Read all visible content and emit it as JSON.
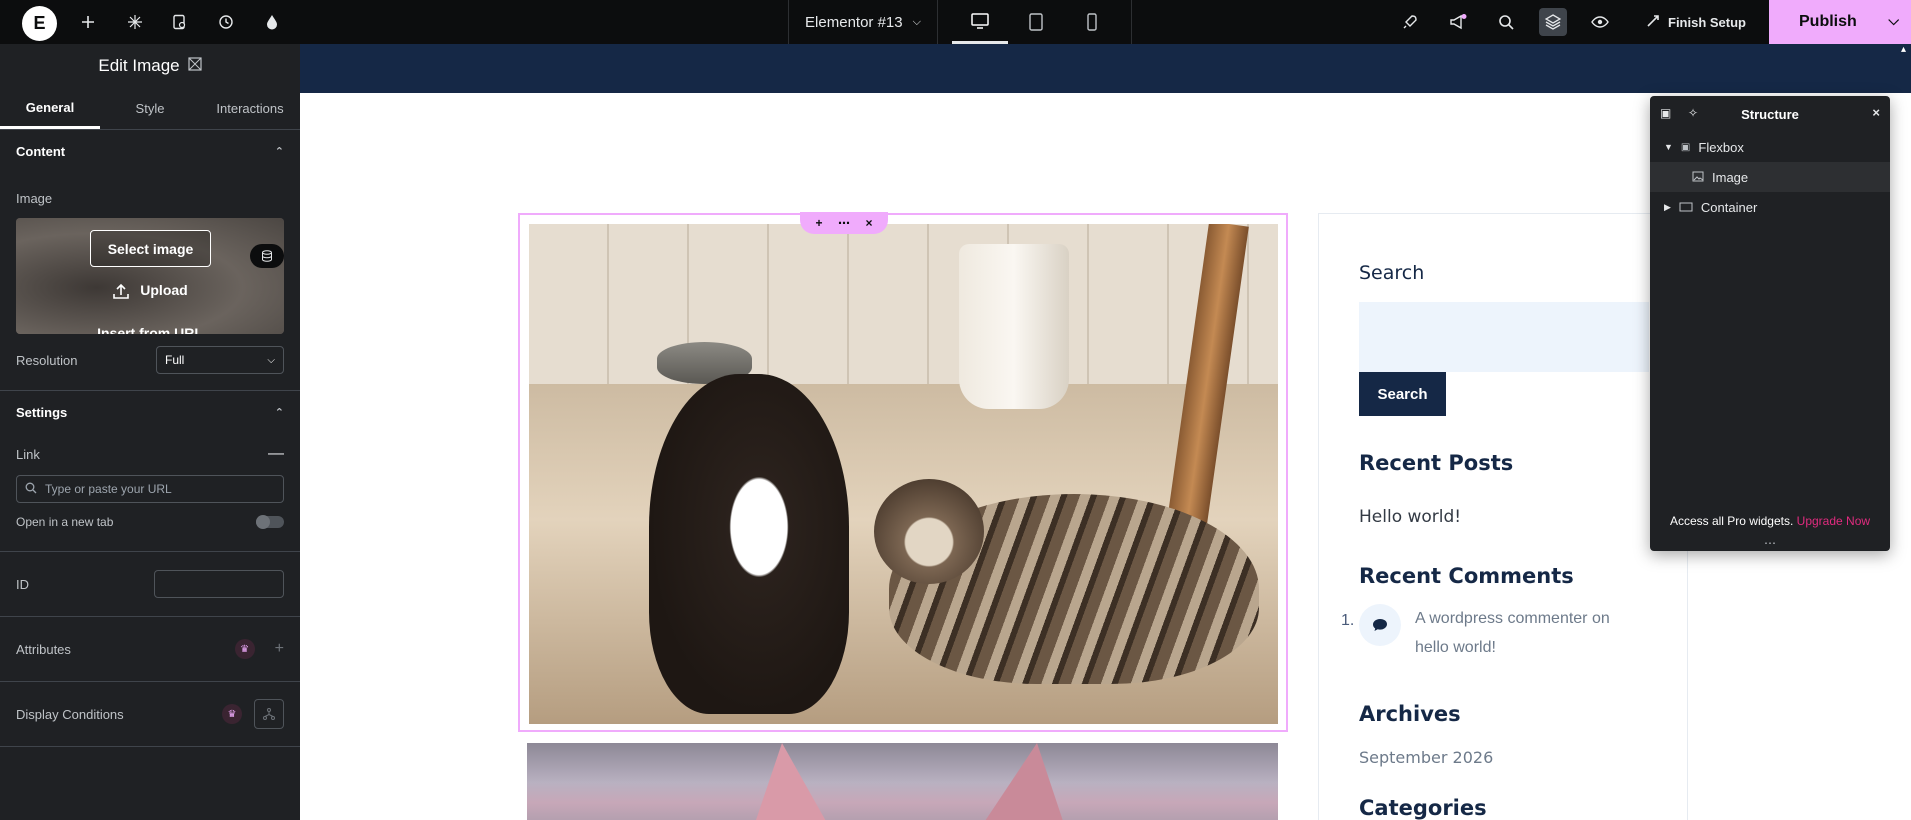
{
  "topbar": {
    "logo": "E",
    "doc_title": "Elementor #13",
    "finish_setup": "Finish Setup",
    "publish": "Publish"
  },
  "panel": {
    "title": "Edit Image",
    "tabs": [
      "General",
      "Style",
      "Interactions"
    ],
    "content_section": "Content",
    "image_label": "Image",
    "select_image": "Select image",
    "upload": "Upload",
    "insert_url": "Insert from URL",
    "resolution_label": "Resolution",
    "resolution_value": "Full",
    "settings_section": "Settings",
    "link_label": "Link",
    "link_placeholder": "Type or paste your URL",
    "new_tab_label": "Open in a new tab",
    "id_label": "ID",
    "attributes_label": "Attributes",
    "display_conditions_label": "Display Conditions"
  },
  "sidebar": {
    "search_title": "Search",
    "search_button": "Search",
    "recent_posts": "Recent Posts",
    "post_1": "Hello world!",
    "recent_comments": "Recent Comments",
    "comment_num": "1.",
    "comment_text": "A wordpress commenter on hello world!",
    "archives": "Archives",
    "archive_1": "September 2026",
    "categories": "Categories"
  },
  "structure": {
    "title": "Structure",
    "items": [
      {
        "label": "Flexbox"
      },
      {
        "label": "Image"
      },
      {
        "label": "Container"
      }
    ],
    "footer_text": "Access all Pro widgets.",
    "footer_link": "Upgrade Now"
  },
  "colors": {
    "accent_pink": "#f0abfc",
    "panel_bg": "#1f2124",
    "topbar_bg": "#0c0d0e",
    "site_navy": "#152846"
  }
}
